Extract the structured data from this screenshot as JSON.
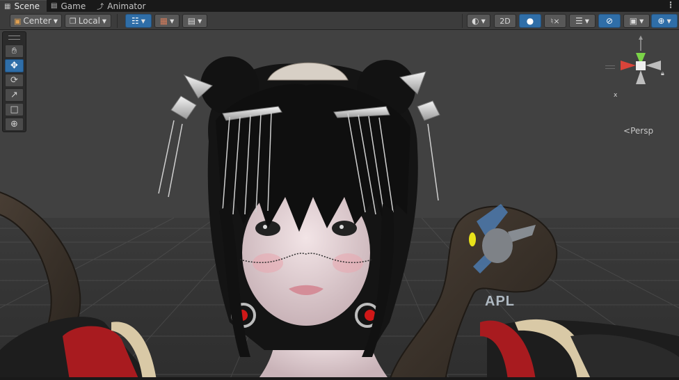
{
  "tabs": [
    {
      "label": "Scene",
      "icon": "grid-icon",
      "active": true
    },
    {
      "label": "Game",
      "icon": "gamepad-icon",
      "active": false
    },
    {
      "label": "Animator",
      "icon": "animator-icon",
      "active": false
    }
  ],
  "tab_menu": "⋮",
  "toolbar": {
    "pivot_label": "Center",
    "space_label": "Local",
    "view_2d_label": "2D"
  },
  "gizmo": {
    "x_label": "x",
    "projection_label": "Persp"
  },
  "watermark_text": "APL",
  "colors": {
    "toolbar_bg": "#3c3c3c",
    "accent_blue": "#2f6ea8",
    "viewport_bg": "#414141",
    "gizmo_x": "#d9443a",
    "gizmo_y": "#7bd348",
    "gizmo_z": "#4a82d6"
  }
}
